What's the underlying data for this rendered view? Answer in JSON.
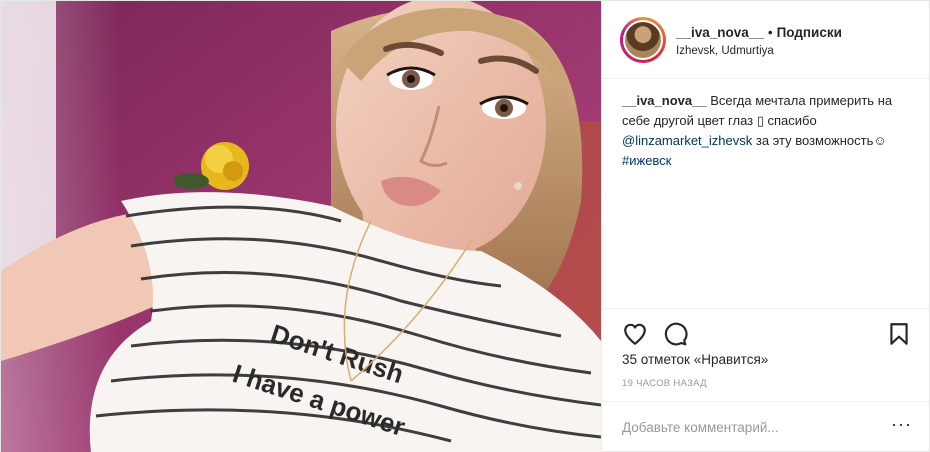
{
  "post": {
    "username": "__iva_nova__",
    "separator": "•",
    "follow_label": "Подписки",
    "location": "Izhevsk, Udmurtiya",
    "caption": {
      "user": "__iva_nova__",
      "text_part1": "Всегда мечтала примерить на себе другой цвет глаз ",
      "emoji_box": "▯",
      "text_part2": " спасибо",
      "mention": "@linzamarket_izhevsk",
      "text_part3": " за эту возможность",
      "emoji_face": "☺",
      "hashtag": "#ижевск"
    },
    "likes_text": "35 отметок «Нравится»",
    "time_ago": "19 часов назад",
    "comment_placeholder": "Добавьте комментарий...",
    "more_label": "···",
    "photo_shirt_line1": "Don't Rush",
    "photo_shirt_line2": "I have a power"
  },
  "icons": {
    "like": "heart-icon",
    "comment": "comment-icon",
    "save": "bookmark-icon"
  },
  "colors": {
    "link": "#003569",
    "muted": "#999999",
    "border": "#efefef",
    "avatar_ring_start": "#f09433",
    "avatar_ring_end": "#bc1888"
  }
}
